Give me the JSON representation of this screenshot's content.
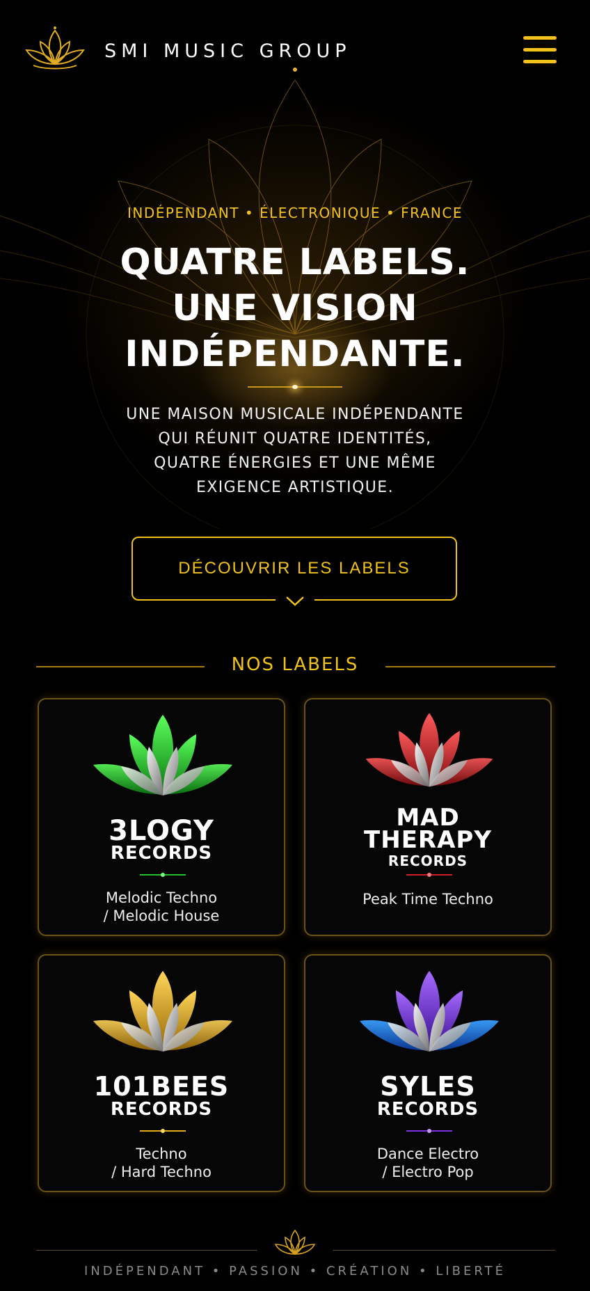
{
  "header": {
    "brand": "SMI MUSIC GROUP",
    "logo_icon": "lotus-logo-icon",
    "menu_icon": "hamburger-menu-icon"
  },
  "hero": {
    "tagline": "INDÉPENDANT • ÉLECTRONIQUE • FRANCE",
    "title_line1": "QUATRE LABELS.",
    "title_line2": "UNE VISION",
    "title_line3": "INDÉPENDANTE.",
    "desc_line1": "UNE MAISON MUSICALE INDÉPENDANTE",
    "desc_line2": "QUI RÉUNIT QUATRE IDENTITÉS,",
    "desc_line3": "QUATRE ÉNERGIES ET UNE MÊME",
    "desc_line4": "EXIGENCE ARTISTIQUE.",
    "cta_label": "DÉCOUVRIR LES LABELS",
    "cta_icon": "chevron-down-icon"
  },
  "labels_section": {
    "title": "NOS LABELS",
    "cards": [
      {
        "name1": "3LOGY",
        "name2": "RECORDS",
        "genre1": "Melodic Techno",
        "genre2": "/ Melodic House",
        "color": "#22c02a"
      },
      {
        "name1": "MAD",
        "name2": "THERAPY",
        "name3": "RECORDS",
        "genre1": "Peak Time Techno",
        "color": "#d01e24"
      },
      {
        "name1": "101BEES",
        "name2": "RECORDS",
        "genre1": "Techno",
        "genre2": "/ Hard Techno",
        "color": "#e7a91a"
      },
      {
        "name1": "SYLES",
        "name2": "RECORDS",
        "genre1": "Dance Electro",
        "genre2": "/ Electro Pop",
        "color": "#7a2fe0"
      }
    ]
  },
  "footer": {
    "tagline": "INDÉPENDANT • PASSION • CRÉATION • LIBERTÉ"
  },
  "colors": {
    "accent": "#f1c21b",
    "background": "#000000"
  }
}
